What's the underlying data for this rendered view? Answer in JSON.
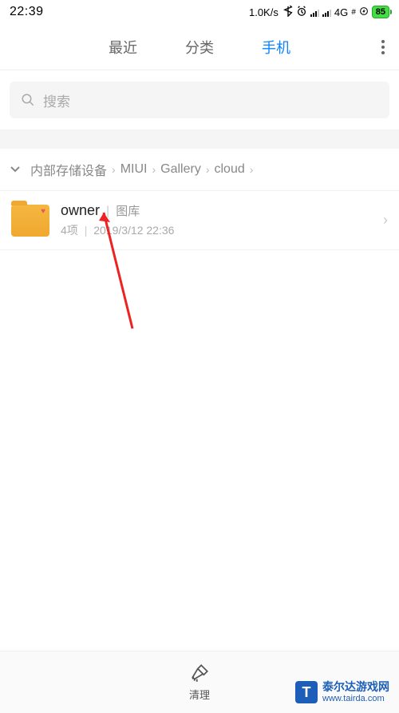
{
  "status": {
    "time": "22:39",
    "speed": "1.0K/s",
    "network_label": "4G",
    "battery": "85"
  },
  "tabs": {
    "items": [
      {
        "label": "最近"
      },
      {
        "label": "分类"
      },
      {
        "label": "手机"
      }
    ],
    "active_index": 2
  },
  "search": {
    "placeholder": "搜索"
  },
  "breadcrumb": {
    "items": [
      {
        "label": "内部存储设备"
      },
      {
        "label": "MIUI"
      },
      {
        "label": "Gallery"
      },
      {
        "label": "cloud"
      }
    ]
  },
  "files": [
    {
      "name": "owner",
      "tag": "图库",
      "count": "4项",
      "date": "2019/3/12 22:36"
    }
  ],
  "bottom": {
    "clean_label": "清理"
  },
  "watermark": {
    "name": "泰尔达游戏网",
    "url": "www.tairda.com"
  }
}
